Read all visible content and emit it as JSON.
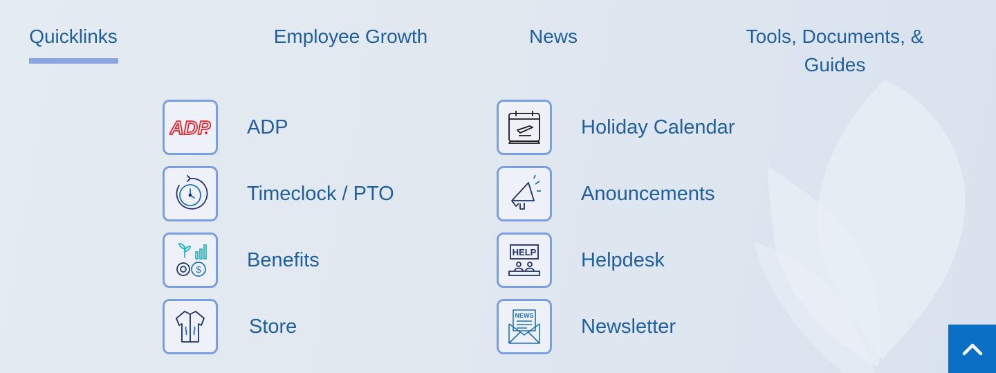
{
  "tabs": [
    {
      "label": "Quicklinks",
      "active": true
    },
    {
      "label": "Employee Growth",
      "active": false
    },
    {
      "label": "News",
      "active": false
    },
    {
      "label": "Tools, Documents, & Guides",
      "active": false
    }
  ],
  "links_left": [
    {
      "label": "ADP",
      "icon": "adp-logo-icon"
    },
    {
      "label": "Timeclock / PTO",
      "icon": "clock-icon"
    },
    {
      "label": "Benefits",
      "icon": "benefits-growth-icon"
    },
    {
      "label": "Store",
      "icon": "shirt-icon"
    }
  ],
  "links_right": [
    {
      "label": "Holiday Calendar",
      "icon": "calendar-plane-icon"
    },
    {
      "label": "Anouncements",
      "icon": "megaphone-icon"
    },
    {
      "label": "Helpdesk",
      "icon": "help-sign-icon"
    },
    {
      "label": "Newsletter",
      "icon": "news-envelope-icon"
    }
  ],
  "adp_logo_text": "ADP",
  "help_sign_text": "HELP",
  "news_text": "NEWS",
  "colors": {
    "text": "#1f5fa0",
    "tab_underline": "#8aa5e0",
    "icon_border": "#7b9ee1",
    "scroll_button": "#0b70c5",
    "adp_red": "#e4232a",
    "icon_teal": "#18b3c4",
    "icon_navy": "#1d2f6b"
  },
  "scroll_top_icon": "chevron-up-icon"
}
